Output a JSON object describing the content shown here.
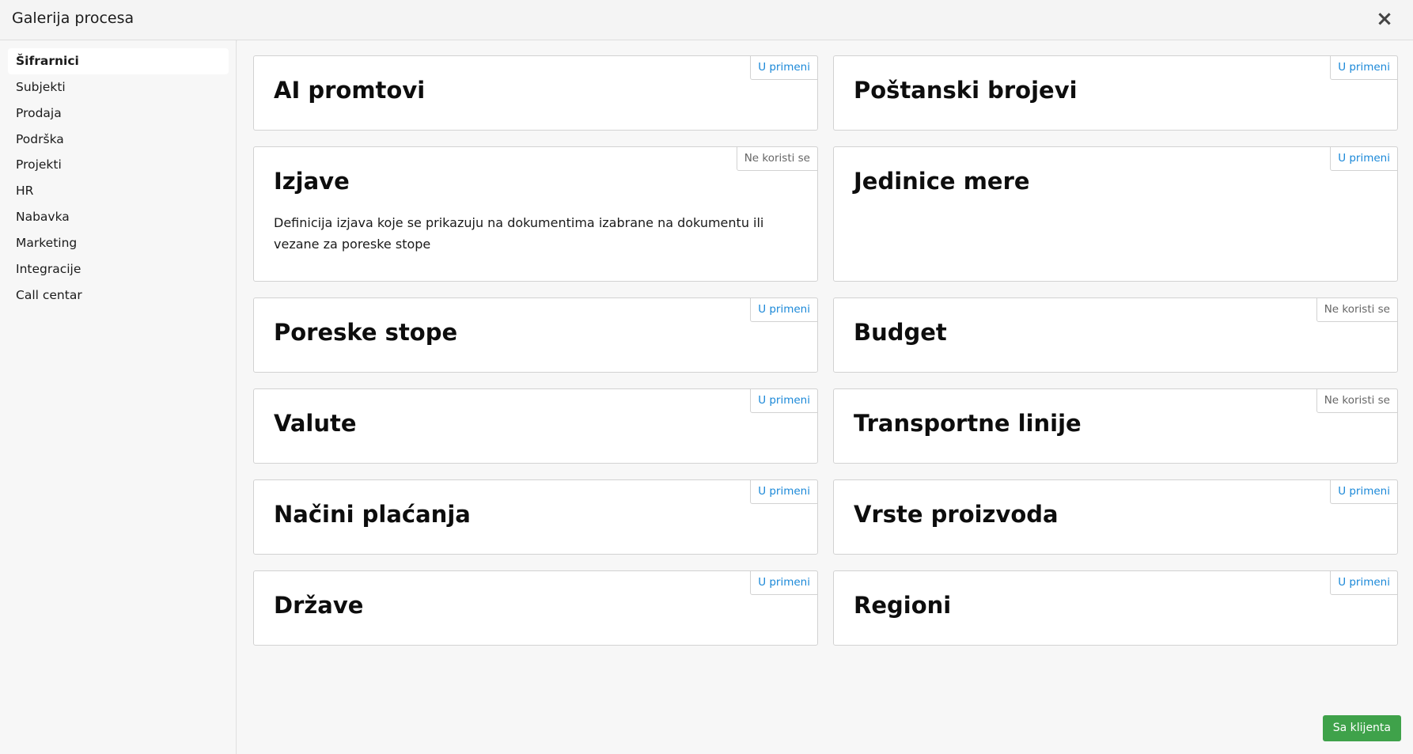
{
  "header": {
    "title": "Galerija procesa",
    "close_icon": "×"
  },
  "sidebar": {
    "items": [
      {
        "label": "Šifrarnici",
        "active": true
      },
      {
        "label": "Subjekti"
      },
      {
        "label": "Prodaja"
      },
      {
        "label": "Podrška"
      },
      {
        "label": "Projekti"
      },
      {
        "label": "HR"
      },
      {
        "label": "Nabavka"
      },
      {
        "label": "Marketing"
      },
      {
        "label": "Integracije"
      },
      {
        "label": "Call centar"
      }
    ]
  },
  "cards": [
    {
      "title": "AI promtovi",
      "badge": "U primeni",
      "status_color": "#1a88d8"
    },
    {
      "title": "Poštanski brojevi",
      "badge": "U primeni",
      "status_color": "#1a88d8"
    },
    {
      "title": "Izjave",
      "badge": "Ne koristi se",
      "status_color": "#666666",
      "description": "Definicija izjava koje se prikazuju na dokumentima izabrane na dokumentu ili vezane za poreske stope"
    },
    {
      "title": "Jedinice mere",
      "badge": "U primeni",
      "status_color": "#1a88d8"
    },
    {
      "title": "Poreske stope",
      "badge": "U primeni",
      "status_color": "#1a88d8"
    },
    {
      "title": "Budget",
      "badge": "Ne koristi se",
      "status_color": "#666666"
    },
    {
      "title": "Valute",
      "badge": "U primeni",
      "status_color": "#1a88d8"
    },
    {
      "title": "Transportne linije",
      "badge": "Ne koristi se",
      "status_color": "#666666"
    },
    {
      "title": "Načini plaćanja",
      "badge": "U primeni",
      "status_color": "#1a88d8"
    },
    {
      "title": "Vrste proizvoda",
      "badge": "U primeni",
      "status_color": "#1a88d8"
    },
    {
      "title": "Države",
      "badge": "U primeni",
      "status_color": "#1a88d8"
    },
    {
      "title": "Regioni",
      "badge": "U primeni",
      "status_color": "#1a88d8"
    }
  ],
  "footer": {
    "button_label": "Sa klijenta",
    "button_color": "#3fa24a"
  }
}
